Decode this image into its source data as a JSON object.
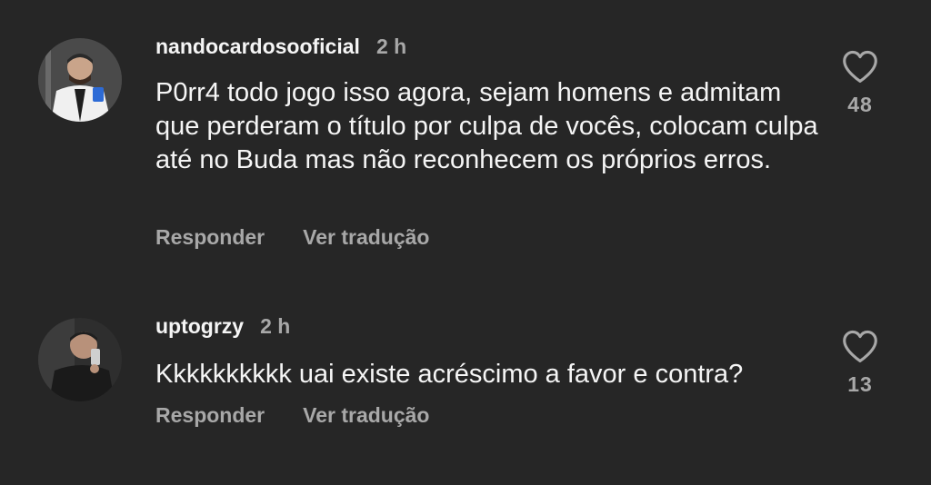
{
  "comments": [
    {
      "username": "nandocardosooficial",
      "time": "2 h",
      "text": "P0rr4 todo jogo isso agora, sejam homens e admitam que perderam o título por culpa de vocês, colocam culpa até no Buda mas não reconhecem os próprios erros.",
      "reply_label": "Responder",
      "translate_label": "Ver tradução",
      "likes": "48",
      "like_icon": "heart-outline-icon"
    },
    {
      "username": "uptogrzy",
      "time": "2 h",
      "text": "Kkkkkkkkkk uai existe acréscimo a favor e contra?",
      "reply_label": "Responder",
      "translate_label": "Ver tradução",
      "likes": "13",
      "like_icon": "heart-outline-icon"
    }
  ],
  "colors": {
    "background": "#262626",
    "primary_text": "#f5f5f5",
    "secondary_text": "#a8a8a8"
  }
}
